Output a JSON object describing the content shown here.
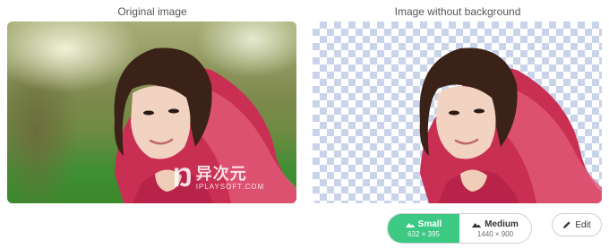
{
  "original": {
    "title": "Original image"
  },
  "result": {
    "title": "Image without background"
  },
  "watermark": {
    "chinese": "异次元",
    "latin": "IPLAYSOFT.COM"
  },
  "resolution_options": [
    {
      "label": "Small",
      "dimensions": "632 × 395",
      "selected": true,
      "icon": "landscape-image-icon"
    },
    {
      "label": "Medium",
      "dimensions": "1440 × 900",
      "selected": false,
      "icon": "landscape-image-icon"
    }
  ],
  "edit_button": {
    "label": "Edit",
    "icon": "pencil-icon"
  },
  "colors": {
    "accent": "#3cc983",
    "checker": "#c9d3ea",
    "scarf": "#d23a5c"
  }
}
